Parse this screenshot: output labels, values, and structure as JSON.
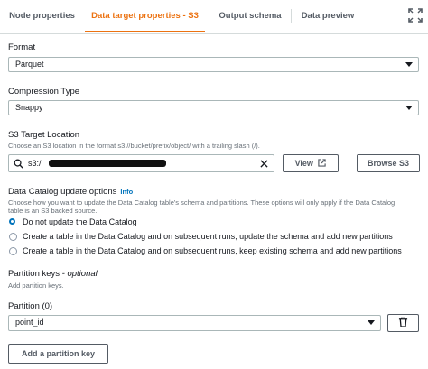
{
  "tabs": [
    {
      "label": "Node properties"
    },
    {
      "label": "Data target properties - S3"
    },
    {
      "label": "Output schema"
    },
    {
      "label": "Data preview"
    }
  ],
  "format": {
    "label": "Format",
    "value": "Parquet"
  },
  "compression": {
    "label": "Compression Type",
    "value": "Snappy"
  },
  "s3": {
    "label": "S3 Target Location",
    "description": "Choose an S3 location in the format s3://bucket/prefix/object/ with a trailing slash (/).",
    "value": "s3:/",
    "view_button": "View",
    "browse_button": "Browse S3"
  },
  "catalog": {
    "label": "Data Catalog update options",
    "info": "Info",
    "description_line1": "Choose how you want to update the Data Catalog table's schema and partitions. These options will only apply if the Data Catalog",
    "description_line2": "table is an S3 backed source.",
    "options": [
      {
        "label": "Do not update the Data Catalog",
        "selected": true
      },
      {
        "label": "Create a table in the Data Catalog and on subsequent runs, update the schema and add new partitions",
        "selected": false
      },
      {
        "label": "Create a table in the Data Catalog and on subsequent runs, keep existing schema and add new partitions",
        "selected": false
      }
    ]
  },
  "partition_keys": {
    "label": "Partition keys",
    "optional": "- optional",
    "description": "Add partition keys."
  },
  "partition": {
    "label": "Partition (0)",
    "value": "point_id"
  },
  "add_partition_button": "Add a partition key",
  "colors": {
    "accent": "#ec7211",
    "link": "#0073bb"
  }
}
